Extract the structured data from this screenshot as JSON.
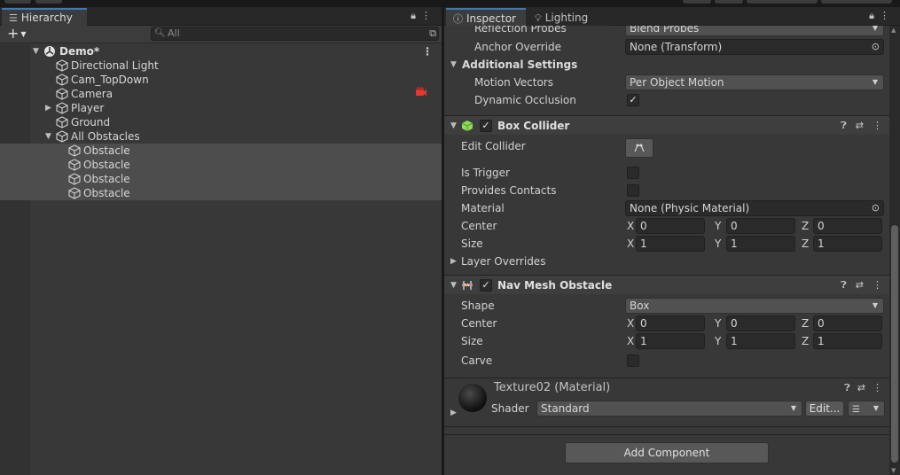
{
  "hierarchy": {
    "tab_label": "Hierarchy",
    "search_placeholder": "All",
    "scene_name": "Demo*",
    "items": [
      {
        "label": "Directional Light"
      },
      {
        "label": "Cam_TopDown"
      },
      {
        "label": "Camera"
      },
      {
        "label": "Player"
      },
      {
        "label": "Ground"
      },
      {
        "label": "All Obstacles"
      },
      {
        "label": "Obstacle"
      },
      {
        "label": "Obstacle"
      },
      {
        "label": "Obstacle"
      },
      {
        "label": "Obstacle"
      }
    ]
  },
  "inspector": {
    "tab_label": "Inspector",
    "lighting_tab_label": "Lighting",
    "reflection_probes": {
      "label": "Reflection Probes",
      "value": "Blend Probes"
    },
    "anchor_override": {
      "label": "Anchor Override",
      "value": "None (Transform)"
    },
    "additional_settings": {
      "title": "Additional Settings"
    },
    "motion_vectors": {
      "label": "Motion Vectors",
      "value": "Per Object Motion"
    },
    "dynamic_occlusion": {
      "label": "Dynamic Occlusion",
      "checked": true
    },
    "box_collider": {
      "title": "Box Collider",
      "edit_collider_label": "Edit Collider",
      "is_trigger_label": "Is Trigger",
      "provides_contacts_label": "Provides Contacts",
      "material_label": "Material",
      "material_value": "None (Physic Material)",
      "center_label": "Center",
      "center": {
        "x": "0",
        "y": "0",
        "z": "0"
      },
      "size_label": "Size",
      "size": {
        "x": "1",
        "y": "1",
        "z": "1"
      },
      "layer_overrides_label": "Layer Overrides"
    },
    "nav_mesh_obstacle": {
      "title": "Nav Mesh Obstacle",
      "shape_label": "Shape",
      "shape_value": "Box",
      "center_label": "Center",
      "center": {
        "x": "0",
        "y": "0",
        "z": "0"
      },
      "size_label": "Size",
      "size": {
        "x": "1",
        "y": "1",
        "z": "1"
      },
      "carve_label": "Carve"
    },
    "material": {
      "name": "Texture02 (Material)",
      "shader_label": "Shader",
      "shader_value": "Standard",
      "edit_label": "Edit..."
    },
    "add_component_label": "Add Component",
    "axis": {
      "x": "X",
      "y": "Y",
      "z": "Z"
    }
  },
  "colors": {
    "selection": "#4d4d4d",
    "tab_accent": "#3a79bb",
    "camera_gizmo": "#e23a2e",
    "box_collider_icon": "#8fdc5a"
  }
}
